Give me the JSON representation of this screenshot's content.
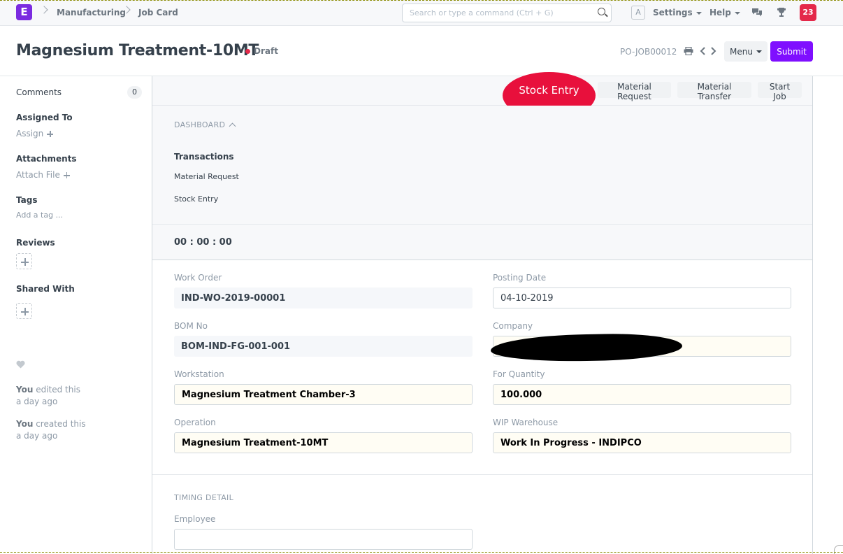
{
  "navbar": {
    "logo_letter": "E",
    "breadcrumbs": [
      "Manufacturing",
      "Job Card"
    ],
    "search_placeholder": "Search or type a command (Ctrl + G)",
    "avatar_letter": "A",
    "settings_label": "Settings",
    "help_label": "Help",
    "notification_count": "23",
    "icons": [
      "chevron-right-icon",
      "search-icon",
      "chat-icon",
      "trophy-icon"
    ]
  },
  "header": {
    "title": "Magnesium Treatment-10MT",
    "status": "Draft",
    "status_color": "#e4294a",
    "docname": "PO-JOB00012",
    "menu_label": "Menu",
    "submit_label": "Submit",
    "accent_color": "#7f0fff",
    "icons": [
      "print-icon",
      "chevron-left-icon",
      "chevron-right-icon"
    ]
  },
  "sidebar": {
    "comments_label": "Comments",
    "comments_count": "0",
    "assigned_to_label": "Assigned To",
    "assign_label": "Assign",
    "attachments_label": "Attachments",
    "attach_file_label": "Attach File",
    "tags_label": "Tags",
    "add_tag_label": "Add a tag ...",
    "reviews_label": "Reviews",
    "shared_with_label": "Shared With",
    "activity": [
      {
        "user": "You",
        "action": "edited this",
        "time": "a day ago"
      },
      {
        "user": "You",
        "action": "created this",
        "time": "a day ago"
      }
    ]
  },
  "toolbar": {
    "stock_entry_label": "Stock Entry",
    "highlight_color": "#e8103c",
    "material_request_label": "Material Request",
    "material_transfer_label": "Material Transfer",
    "start_job_label": "Start Job"
  },
  "dashboard": {
    "section_title": "DASHBOARD",
    "transactions_heading": "Transactions",
    "links": [
      "Material Request",
      "Stock Entry"
    ]
  },
  "timer": {
    "value": "00 : 00 : 00"
  },
  "form": {
    "work_order_label": "Work Order",
    "work_order_value": "IND-WO-2019-00001",
    "posting_date_label": "Posting Date",
    "posting_date_value": "04-10-2019",
    "bom_no_label": "BOM No",
    "bom_no_value": "BOM-IND-FG-001-001",
    "company_label": "Company",
    "company_value": "",
    "workstation_label": "Workstation",
    "workstation_value": "Magnesium Treatment Chamber-3",
    "for_quantity_label": "For Quantity",
    "for_quantity_value": "100.000",
    "operation_label": "Operation",
    "operation_value": "Magnesium Treatment-10MT",
    "wip_warehouse_label": "WIP Warehouse",
    "wip_warehouse_value": "Work In Progress - INDIPCO"
  },
  "timing": {
    "section_title": "TIMING DETAIL",
    "employee_label": "Employee",
    "employee_value": ""
  }
}
